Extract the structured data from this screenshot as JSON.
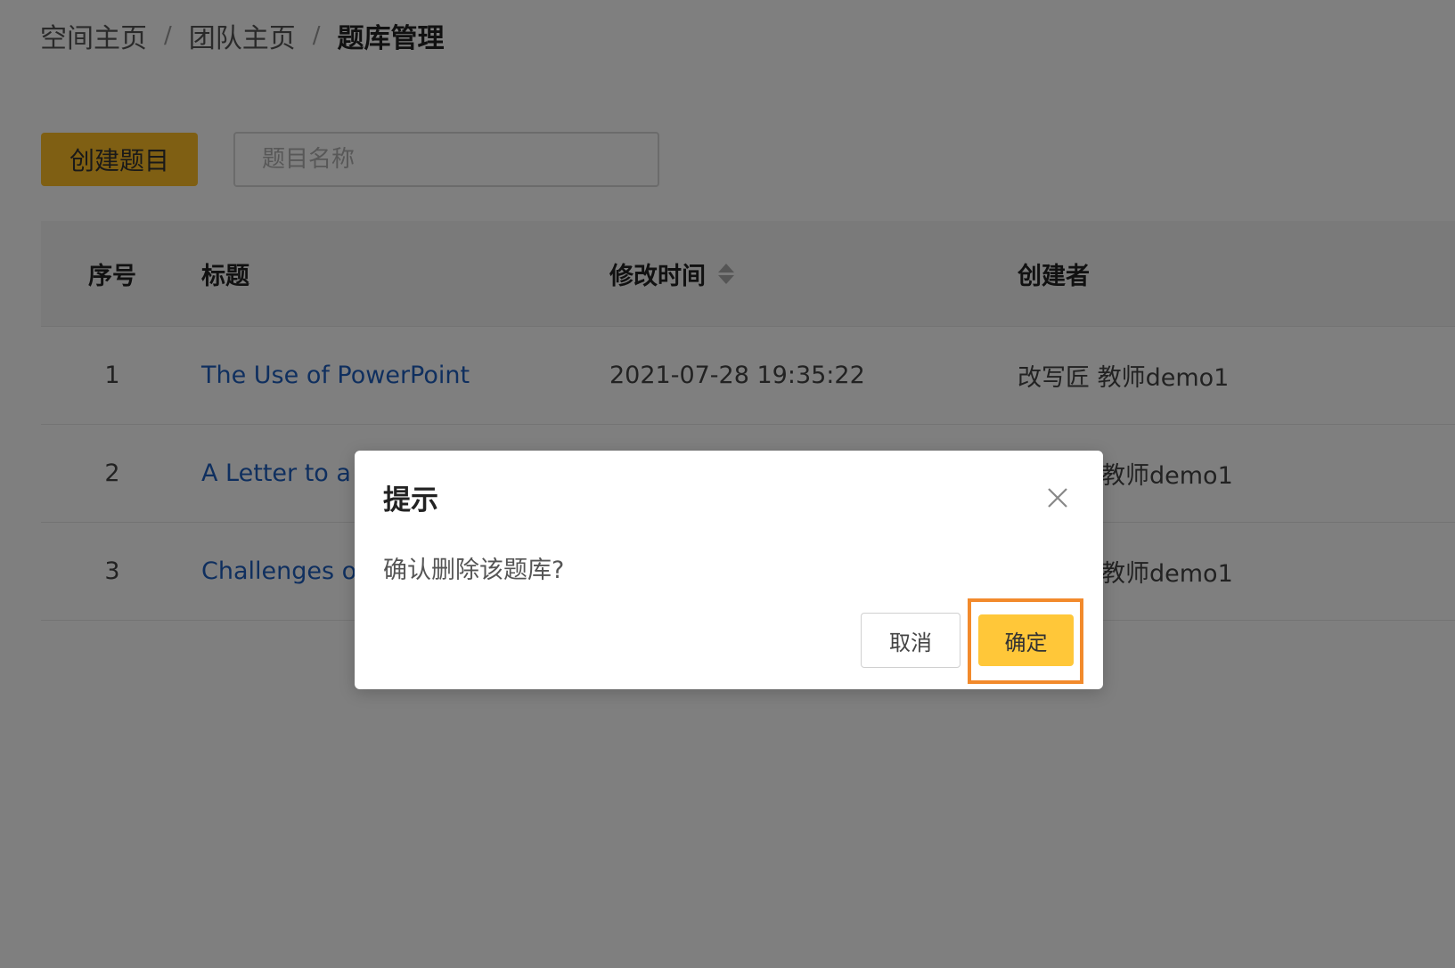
{
  "breadcrumb": {
    "items": [
      "空间主页",
      "团队主页",
      "题库管理"
    ],
    "separator": "/"
  },
  "toolbar": {
    "create_label": "创建题目",
    "search_placeholder": "题目名称",
    "search_value": ""
  },
  "table": {
    "headers": {
      "index": "序号",
      "title": "标题",
      "time": "修改时间",
      "creator": "创建者"
    },
    "rows": [
      {
        "index": "1",
        "title": "The Use of PowerPoint",
        "time": "2021-07-28 19:35:22",
        "creator": "改写匠 教师demo1"
      },
      {
        "index": "2",
        "title": "A Letter to a F",
        "time": "",
        "creator": "教师demo1"
      },
      {
        "index": "3",
        "title": "Challenges of",
        "time": "",
        "creator": "教师demo1"
      }
    ]
  },
  "dialog": {
    "title": "提示",
    "message": "确认删除该题库?",
    "cancel_label": "取消",
    "confirm_label": "确定"
  },
  "colors": {
    "accent": "#ffc739",
    "link": "#1f5fbf",
    "highlight": "#f28a2c",
    "mask": "rgba(0,0,0,0.5)"
  }
}
